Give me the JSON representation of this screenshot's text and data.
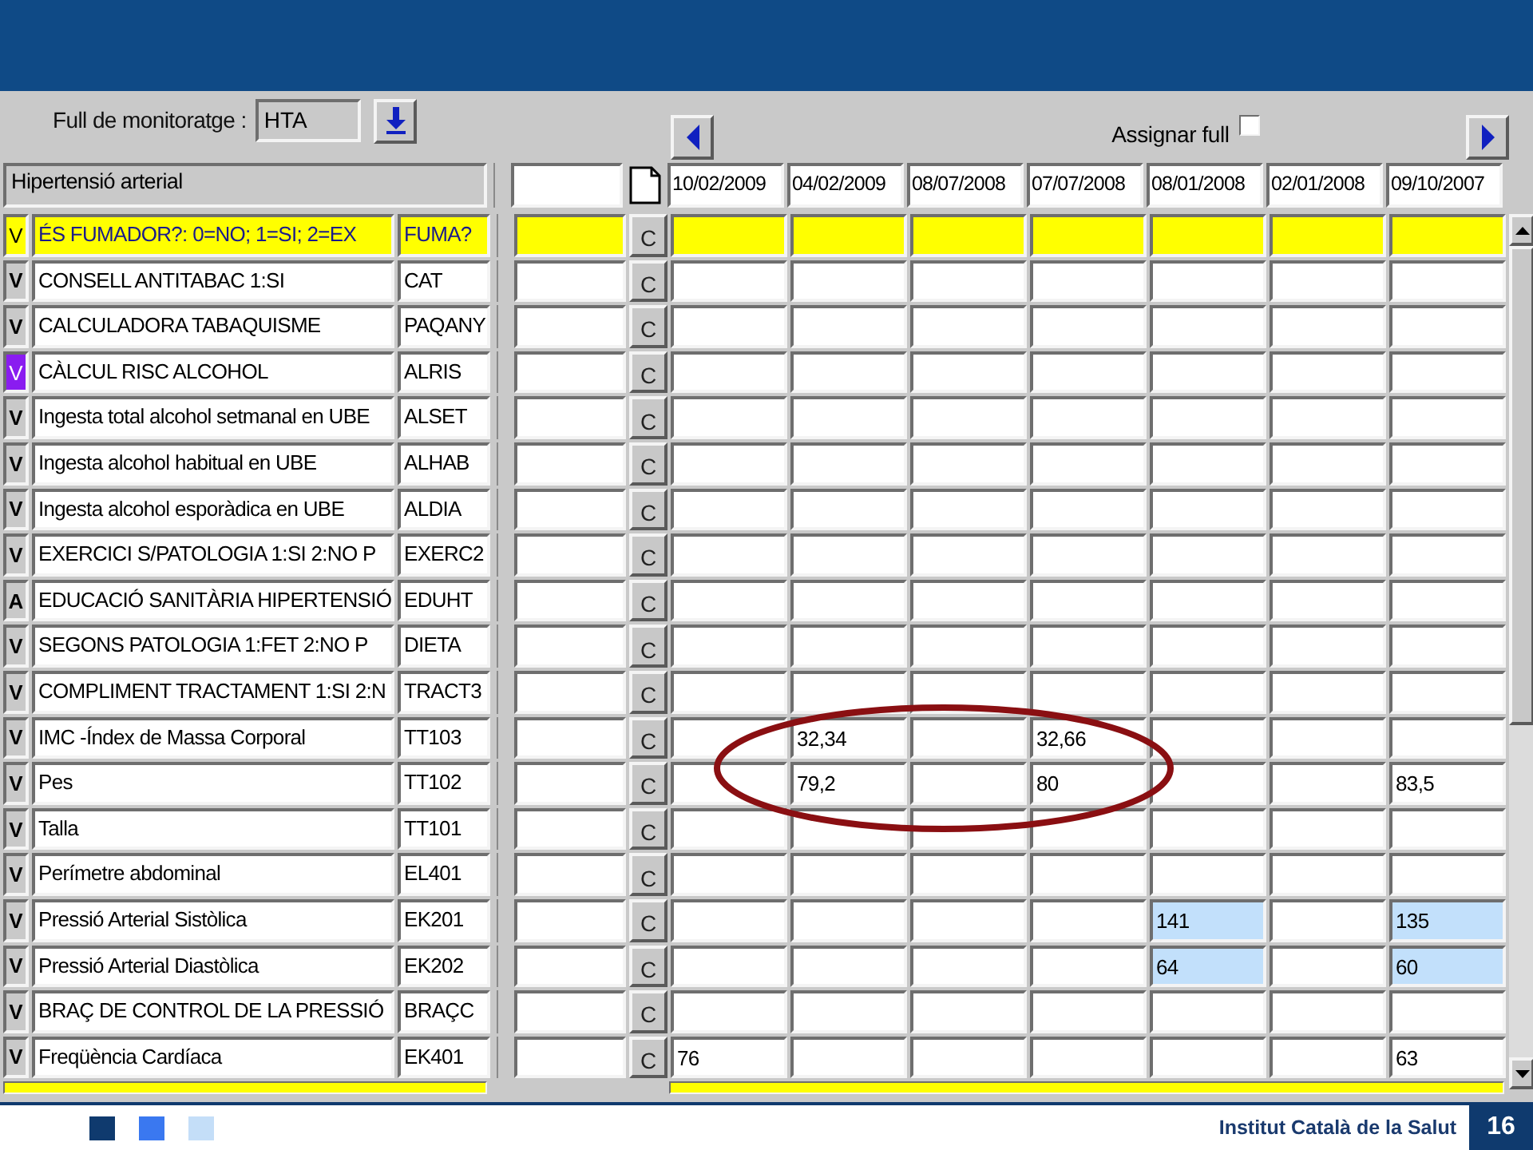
{
  "toolbar": {
    "label": "Full de monitoratge :",
    "sheet_code": "HTA",
    "assign_label": "Assignar full",
    "assign_checked": false
  },
  "sheet_title": "Hipertensió arterial",
  "dates": [
    "10/02/2009",
    "04/02/2009",
    "08/07/2008",
    "07/07/2008",
    "08/01/2008",
    "02/01/2008",
    "09/10/2007"
  ],
  "rows": [
    {
      "flag": "V",
      "flag_highlighted": false,
      "selected": true,
      "name": "ÉS FUMADOR?: 0=NO; 1=SI; 2=EX",
      "code": "FUMA?",
      "button": "C",
      "cells": [
        {
          "highlighted": false
        },
        {
          "highlighted": false
        },
        {
          "highlighted": false
        },
        {
          "highlighted": false
        },
        {
          "highlighted": false
        },
        {
          "highlighted": false
        },
        {
          "highlighted": false
        }
      ]
    },
    {
      "flag": "V",
      "flag_highlighted": false,
      "selected": false,
      "name": "CONSELL ANTITABAC 1:SI",
      "code": "CAT",
      "button": "C",
      "cells": [
        {
          "highlighted": false
        },
        {
          "highlighted": false
        },
        {
          "highlighted": false
        },
        {
          "highlighted": false
        },
        {
          "highlighted": false
        },
        {
          "highlighted": false
        },
        {
          "highlighted": false
        }
      ]
    },
    {
      "flag": "V",
      "flag_highlighted": false,
      "selected": false,
      "name": "CALCULADORA TABAQUISME",
      "code": "PAQANY",
      "button": "C",
      "cells": [
        {
          "highlighted": false
        },
        {
          "highlighted": false
        },
        {
          "highlighted": false
        },
        {
          "highlighted": false
        },
        {
          "highlighted": false
        },
        {
          "highlighted": false
        },
        {
          "highlighted": false
        }
      ]
    },
    {
      "flag": "V",
      "flag_highlighted": true,
      "selected": false,
      "name": "CÀLCUL RISC ALCOHOL",
      "code": "ALRIS",
      "button": "C",
      "cells": [
        {
          "highlighted": false
        },
        {
          "highlighted": false
        },
        {
          "highlighted": false
        },
        {
          "highlighted": false
        },
        {
          "highlighted": false
        },
        {
          "highlighted": false
        },
        {
          "highlighted": false
        }
      ]
    },
    {
      "flag": "V",
      "flag_highlighted": false,
      "selected": false,
      "name": "Ingesta total alcohol setmanal en UBE",
      "code": "ALSET",
      "button": "C",
      "cells": [
        {
          "highlighted": false
        },
        {
          "highlighted": false
        },
        {
          "highlighted": false
        },
        {
          "highlighted": false
        },
        {
          "highlighted": false
        },
        {
          "highlighted": false
        },
        {
          "highlighted": false
        }
      ]
    },
    {
      "flag": "V",
      "flag_highlighted": false,
      "selected": false,
      "name": "Ingesta alcohol habitual en UBE",
      "code": "ALHAB",
      "button": "C",
      "cells": [
        {
          "highlighted": false
        },
        {
          "highlighted": false
        },
        {
          "highlighted": false
        },
        {
          "highlighted": false
        },
        {
          "highlighted": false
        },
        {
          "highlighted": false
        },
        {
          "highlighted": false
        }
      ]
    },
    {
      "flag": "V",
      "flag_highlighted": false,
      "selected": false,
      "name": "Ingesta alcohol esporàdica en UBE",
      "code": "ALDIA",
      "button": "C",
      "cells": [
        {
          "highlighted": false
        },
        {
          "highlighted": false
        },
        {
          "highlighted": false
        },
        {
          "highlighted": false
        },
        {
          "highlighted": false
        },
        {
          "highlighted": false
        },
        {
          "highlighted": false
        }
      ]
    },
    {
      "flag": "V",
      "flag_highlighted": false,
      "selected": false,
      "name": "EXERCICI S/PATOLOGIA 1:SI 2:NO P",
      "code": "EXERC2",
      "button": "C",
      "cells": [
        {
          "highlighted": false
        },
        {
          "highlighted": false
        },
        {
          "highlighted": false
        },
        {
          "highlighted": false
        },
        {
          "highlighted": false
        },
        {
          "highlighted": false
        },
        {
          "highlighted": false
        }
      ]
    },
    {
      "flag": "A",
      "flag_highlighted": false,
      "selected": false,
      "name": "EDUCACIÓ SANITÀRIA HIPERTENSIÓ",
      "code": "EDUHT",
      "button": "C",
      "cells": [
        {
          "highlighted": false
        },
        {
          "highlighted": false
        },
        {
          "highlighted": false
        },
        {
          "highlighted": false
        },
        {
          "highlighted": false
        },
        {
          "highlighted": false
        },
        {
          "highlighted": false
        }
      ]
    },
    {
      "flag": "V",
      "flag_highlighted": false,
      "selected": false,
      "name": "SEGONS PATOLOGIA 1:FET 2:NO P",
      "code": "DIETA",
      "button": "C",
      "cells": [
        {
          "highlighted": false
        },
        {
          "highlighted": false
        },
        {
          "highlighted": false
        },
        {
          "highlighted": false
        },
        {
          "highlighted": false
        },
        {
          "highlighted": false
        },
        {
          "highlighted": false
        }
      ]
    },
    {
      "flag": "V",
      "flag_highlighted": false,
      "selected": false,
      "name": "COMPLIMENT TRACTAMENT 1:SI 2:N",
      "code": "TRACT3",
      "button": "C",
      "cells": [
        {
          "highlighted": false
        },
        {
          "highlighted": false
        },
        {
          "highlighted": false
        },
        {
          "highlighted": false
        },
        {
          "highlighted": false
        },
        {
          "highlighted": false
        },
        {
          "highlighted": false
        }
      ]
    },
    {
      "flag": "V",
      "flag_highlighted": false,
      "selected": false,
      "name": "IMC -Índex de Massa Corporal",
      "code": "TT103",
      "button": "C",
      "cells": [
        {
          "highlighted": false
        },
        {
          "text": "32,34",
          "highlighted": false
        },
        {
          "highlighted": false
        },
        {
          "text": "32,66",
          "highlighted": false
        },
        {
          "highlighted": false
        },
        {
          "highlighted": false
        },
        {
          "highlighted": false
        }
      ]
    },
    {
      "flag": "V",
      "flag_highlighted": false,
      "selected": false,
      "name": "Pes",
      "code": "TT102",
      "button": "C",
      "cells": [
        {
          "highlighted": false
        },
        {
          "text": "79,2",
          "highlighted": false
        },
        {
          "highlighted": false
        },
        {
          "text": "80",
          "highlighted": false
        },
        {
          "highlighted": false
        },
        {
          "highlighted": false
        },
        {
          "text": "83,5",
          "highlighted": false
        }
      ]
    },
    {
      "flag": "V",
      "flag_highlighted": false,
      "selected": false,
      "name": "Talla",
      "code": "TT101",
      "button": "C",
      "cells": [
        {
          "highlighted": false
        },
        {
          "highlighted": false
        },
        {
          "highlighted": false
        },
        {
          "highlighted": false
        },
        {
          "highlighted": false
        },
        {
          "highlighted": false
        },
        {
          "highlighted": false
        }
      ]
    },
    {
      "flag": "V",
      "flag_highlighted": false,
      "selected": false,
      "name": "Perímetre abdominal",
      "code": "EL401",
      "button": "C",
      "cells": [
        {
          "highlighted": false
        },
        {
          "highlighted": false
        },
        {
          "highlighted": false
        },
        {
          "highlighted": false
        },
        {
          "highlighted": false
        },
        {
          "highlighted": false
        },
        {
          "highlighted": false
        }
      ]
    },
    {
      "flag": "V",
      "flag_highlighted": false,
      "selected": false,
      "name": "Pressió Arterial Sistòlica",
      "code": "EK201",
      "button": "C",
      "cells": [
        {
          "highlighted": false
        },
        {
          "highlighted": false
        },
        {
          "highlighted": false
        },
        {
          "highlighted": false
        },
        {
          "text": "141",
          "highlighted": true
        },
        {
          "highlighted": false
        },
        {
          "text": "135",
          "highlighted": true
        }
      ]
    },
    {
      "flag": "V",
      "flag_highlighted": false,
      "selected": false,
      "name": "Pressió Arterial Diastòlica",
      "code": "EK202",
      "button": "C",
      "cells": [
        {
          "highlighted": false
        },
        {
          "highlighted": false
        },
        {
          "highlighted": false
        },
        {
          "highlighted": false
        },
        {
          "text": "64",
          "highlighted": true
        },
        {
          "highlighted": false
        },
        {
          "text": "60",
          "highlighted": true
        }
      ]
    },
    {
      "flag": "V",
      "flag_highlighted": false,
      "selected": false,
      "name": "BRAÇ DE CONTROL DE LA PRESSIÓ",
      "code": "BRAÇC",
      "button": "C",
      "cells": [
        {
          "highlighted": false
        },
        {
          "highlighted": false
        },
        {
          "highlighted": false
        },
        {
          "highlighted": false
        },
        {
          "highlighted": false
        },
        {
          "highlighted": false
        },
        {
          "highlighted": false
        }
      ]
    },
    {
      "flag": "V",
      "flag_highlighted": false,
      "selected": false,
      "name": "Freqüència Cardíaca",
      "code": "EK401",
      "button": "C",
      "cells": [
        {
          "text": "76",
          "highlighted": false
        },
        {
          "highlighted": false
        },
        {
          "highlighted": false
        },
        {
          "highlighted": false
        },
        {
          "highlighted": false
        },
        {
          "highlighted": false
        },
        {
          "text": "63",
          "highlighted": false
        }
      ]
    }
  ],
  "footer": {
    "organization": "Institut Català de la Salut",
    "page_number": "16"
  }
}
